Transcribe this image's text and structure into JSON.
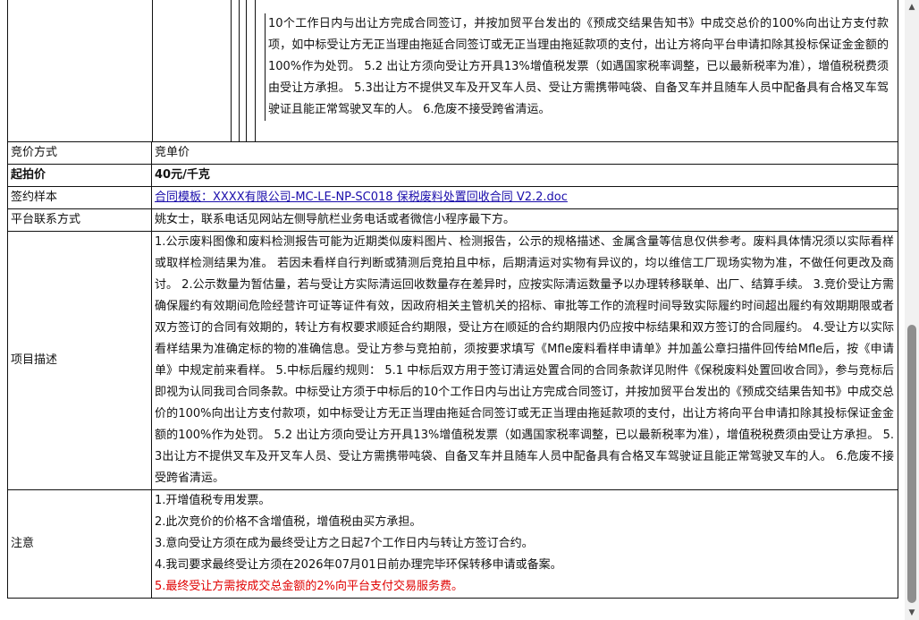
{
  "top_row": {
    "text": "10个工作日内与出让方完成合同签订，并按加贸平台发出的《预成交结果告知书》中成交总价的100%向出让方支付款项，如中标受让方无正当理由拖延合同签订或无正当理由拖延款项的支付，出让方将向平台申请扣除其投标保证金金额的100%作为处罚。 5.2 出让方须向受让方开具13%增值税发票（如遇国家税率调整，已以最新税率为准），增值税税费须由受让方承担。 5.3出让方不提供叉车及开叉车人员、受让方需携带吨袋、自备叉车并且随车人员中配备具有合格叉车驾驶证且能正常驾驶叉车的人。 6.危废不接受跨省清运。"
  },
  "rows": {
    "bidding_method": {
      "label": "竞价方式",
      "value": "竞单价"
    },
    "starting_price": {
      "label": "起拍价",
      "value": "40元/千克"
    },
    "contract_sample": {
      "label": "签约样本",
      "link": "合同模板：XXXX有限公司-MC-LE-NP-SC018 保税废料处置回收合同 V2.2.doc"
    },
    "platform_contact": {
      "label": "平台联系方式",
      "value": "姚女士，联系电话见网站左侧导航栏业务电话或者微信小程序最下方。"
    },
    "project_description": {
      "label": "项目描述",
      "value": "1.公示废料图像和废料检测报告可能为近期类似废料图片、检测报告，公示的规格描述、金属含量等信息仅供参考。废料具体情况须以实际看样或取样检测结果为准。 若因未看样自行判断或猜测后竞拍且中标，后期清运对实物有异议的，均以维信工厂现场实物为准，不做任何更改及商讨。 2.公示数量为暂估量，若与受让方实际清运回收数量存在差异时，应按实际清运数量予以办理转移联单、出厂、结算手续。 3.竞价受让方需确保履约有效期间危险经营许可证等证件有效，因政府相关主管机关的招标、审批等工作的流程时间导致实际履约时间超出履约有效期期限或者双方签订的合同有效期的，转让方有权要求顺延合约期限，受让方在顺延的合约期限内仍应按中标结果和双方签订的合同履约。 4.受让方以实际看样结果为准确定标的物的准确信息。受让方参与竞拍前，须按要求填写《Mfle废料看样申请单》并加盖公章扫描件回传给Mfle后，按《申请单》中规定前来看样。 5.中标后履约规则： 5.1 中标后双方用于签订清运处置合同的合同条款详见附件《保税废料处置回收合同》，参与竞标后即视为认同我司合同条款。中标受让方须于中标后的10个工作日内与出让方完成合同签订，并按加贸平台发出的《预成交结果告知书》中成交总价的100%向出让方支付款项，如中标受让方无正当理由拖延合同签订或无正当理由拖延款项的支付，出让方将向平台申请扣除其投标保证金金额的100%作为处罚。 5.2 出让方须向受让方开具13%增值税发票（如遇国家税率调整，已以最新税率为准），增值税税费须由受让方承担。 5.3出让方不提供叉车及开叉车人员、受让方需携带吨袋、自备叉车并且随车人员中配备具有合格叉车驾驶证且能正常驾驶叉车的人。 6.危废不接受跨省清运。"
    },
    "notes": {
      "label": "注意",
      "items": [
        "1.开增值税专用发票。",
        "2.此次竞价的价格不含增值税，增值税由买方承担。",
        "3.意向受让方须在成为最终受让方之日起7个工作日内与转让方签订合约。",
        "4.我司要求最终受让方须在2026年07月01日前办理完毕环保转移申请或备案。"
      ],
      "warning": "5.最终受让方需按成交总金额的2%向平台支付交易服务费。"
    }
  },
  "colors": {
    "link": "#1a0dab",
    "warning": "#e00000",
    "border": "#111111"
  },
  "scrollbar": {
    "up_icon": "scroll-up-arrow-icon",
    "down_icon": "scroll-down-arrow-icon"
  }
}
